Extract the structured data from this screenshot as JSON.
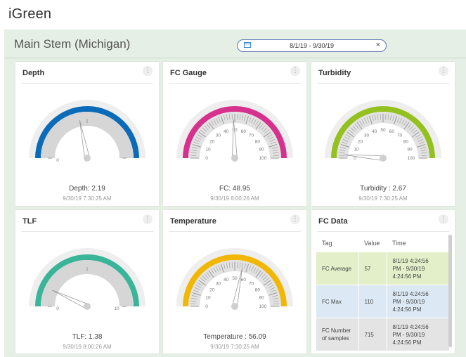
{
  "app": {
    "logo": "iGreen"
  },
  "page": {
    "title": "Main Stem (Michigan)"
  },
  "date_range": {
    "value": "8/1/19 - 9/30/19",
    "clear": "×"
  },
  "menu_glyph": "⋮",
  "gauges": [
    {
      "title": "Depth",
      "reading": "Depth: 2.19",
      "timestamp": "9/30/19 7:30:25 AM",
      "color": "#0b6bb8",
      "min": 0,
      "max": 5,
      "value": 2.19,
      "style": "simple",
      "labels": [
        "0"
      ]
    },
    {
      "title": "FC Gauge",
      "reading": "FC: 48.95",
      "timestamp": "9/30/19 8:00:26 AM",
      "color": "#d6318d",
      "min": 0,
      "max": 100,
      "value": 48.95,
      "style": "ticks",
      "labels": [
        "0",
        "10",
        "20",
        "30",
        "40",
        "50",
        "60",
        "70",
        "80",
        "90",
        "100"
      ]
    },
    {
      "title": "Turbidity",
      "reading": "Turbidity : 2.67",
      "timestamp": "9/30/19 7:30:25 AM",
      "color": "#94c11f",
      "min": 0,
      "max": 100,
      "value": 2.67,
      "style": "ticks",
      "labels": [
        "0",
        "10",
        "20",
        "30",
        "40",
        "50",
        "60",
        "70",
        "80",
        "90",
        "100"
      ]
    },
    {
      "title": "TLF",
      "reading": "TLF: 1.38",
      "timestamp": "9/30/19 8:00:26 AM",
      "color": "#3ab59a",
      "min": 0,
      "max": 10,
      "value": 1.38,
      "style": "simple",
      "labels": [
        "0",
        "10"
      ]
    },
    {
      "title": "Temperature",
      "reading": "Temperature : 56.09",
      "timestamp": "9/30/19 7:30:25 AM",
      "color": "#f2b705",
      "min": 0,
      "max": 100,
      "value": 56.09,
      "style": "ticks",
      "labels": [
        "0",
        "10",
        "20",
        "30",
        "40",
        "50",
        "60",
        "70",
        "80",
        "90",
        "100"
      ]
    }
  ],
  "fc_data": {
    "title": "FC Data",
    "columns": [
      "Tag",
      "Value",
      "Time"
    ],
    "rows": [
      {
        "tag": "FC Average",
        "value": "57",
        "time_lines": [
          "8/1/19 4:24:56",
          "PM - 9/30/19",
          "4:24:56 PM"
        ]
      },
      {
        "tag": "FC Max",
        "value": "110",
        "time_lines": [
          "8/1/19 4:24:56",
          "PM - 9/30/19",
          "4:24:56 PM"
        ]
      },
      {
        "tag_lines": [
          "FC Number",
          "of samples"
        ],
        "value": "715",
        "time_lines": [
          "8/1/19 4:24:56",
          "PM - 9/30/19",
          "4:24:56 PM"
        ]
      }
    ]
  }
}
